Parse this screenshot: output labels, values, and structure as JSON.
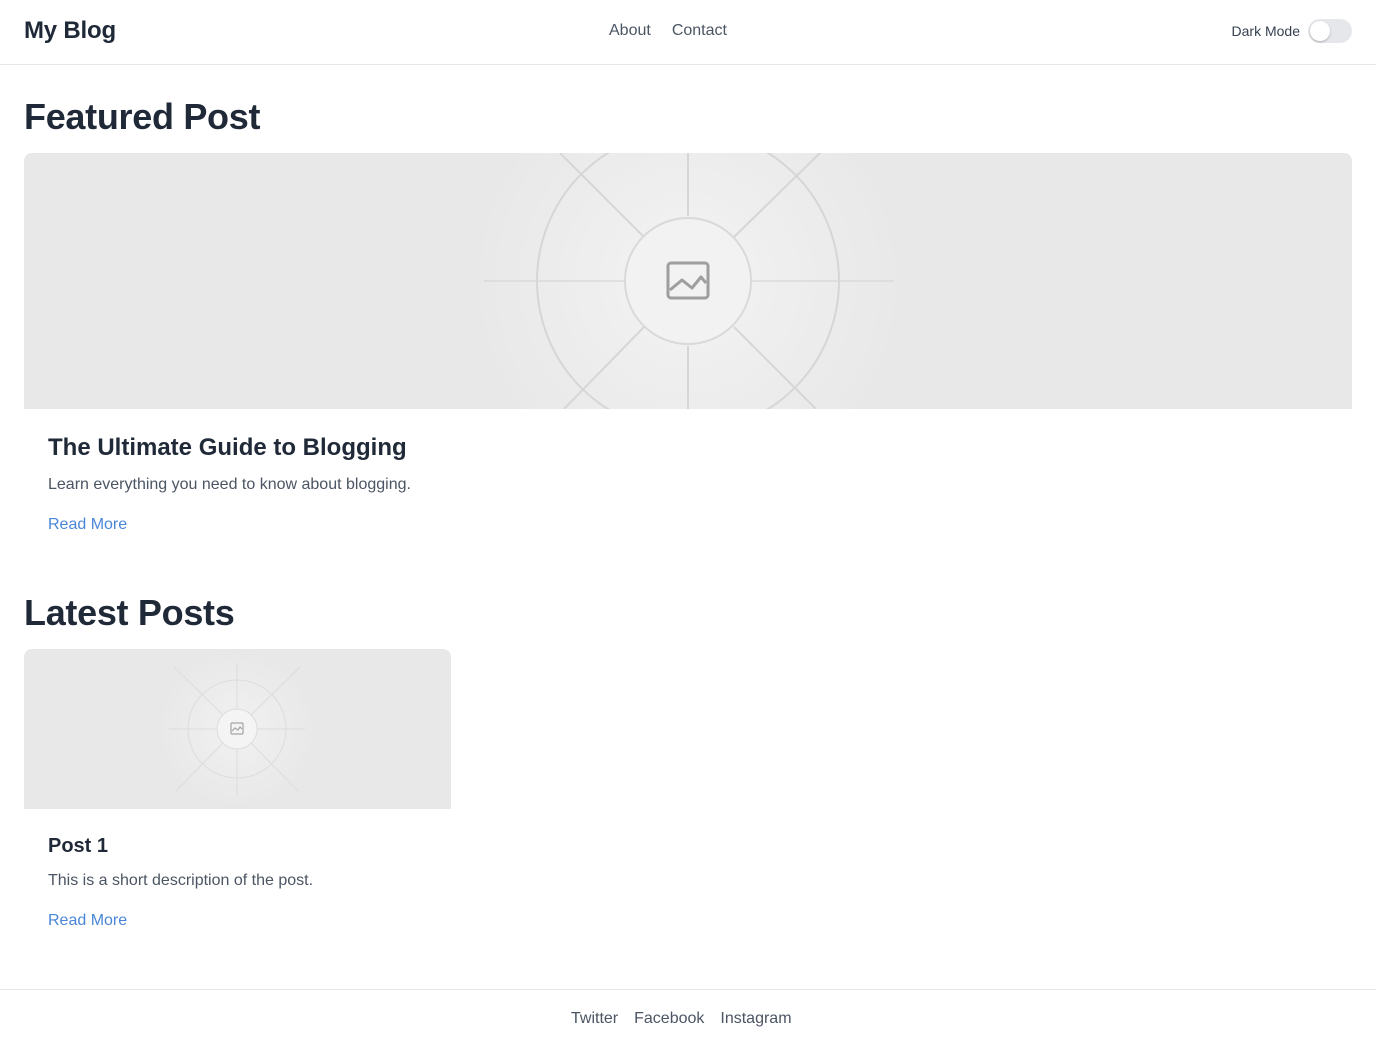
{
  "header": {
    "brand": "My Blog",
    "nav": [
      {
        "label": "About"
      },
      {
        "label": "Contact"
      }
    ],
    "dark_mode_label": "Dark Mode",
    "dark_mode_on": false
  },
  "featured": {
    "section_title": "Featured Post",
    "image_icon": "image-placeholder-icon",
    "post_title": "The Ultimate Guide to Blogging",
    "description": "Learn everything you need to know about blogging.",
    "read_more": "Read More"
  },
  "latest": {
    "section_title": "Latest Posts",
    "posts": [
      {
        "image_icon": "image-placeholder-icon",
        "title": "Post 1",
        "description": "This is a short description of the post.",
        "read_more": "Read More"
      }
    ]
  },
  "footer": {
    "links": [
      {
        "label": "Twitter"
      },
      {
        "label": "Facebook"
      },
      {
        "label": "Instagram"
      }
    ]
  },
  "colors": {
    "text_primary": "#1f2937",
    "text_secondary": "#4b5563",
    "link": "#4a86d8",
    "placeholder_bg": "#e8e8e8",
    "border": "#e5e7eb"
  }
}
